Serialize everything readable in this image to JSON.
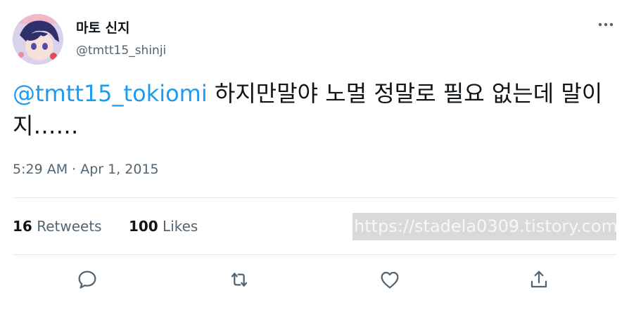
{
  "user": {
    "display_name": "마토 신지",
    "handle": "@tmtt15_shinji"
  },
  "tweet": {
    "mention": "@tmtt15_tokiomi",
    "text": " 하지만말야 노멀 정말로 필요 없는데 말이지……",
    "timestamp": "5:29 AM · Apr 1, 2015"
  },
  "stats": {
    "retweets_count": "16",
    "retweets_label": "Retweets",
    "likes_count": "100",
    "likes_label": "Likes"
  },
  "watermark": "https://stadela0309.tistory.com",
  "icons": {
    "more": "more-horizontal-icon",
    "reply": "reply-icon",
    "retweet": "retweet-icon",
    "like": "heart-icon",
    "share": "share-icon"
  },
  "colors": {
    "mention": "#1d9bf0",
    "secondary_text": "#536471",
    "icon": "#536471"
  }
}
